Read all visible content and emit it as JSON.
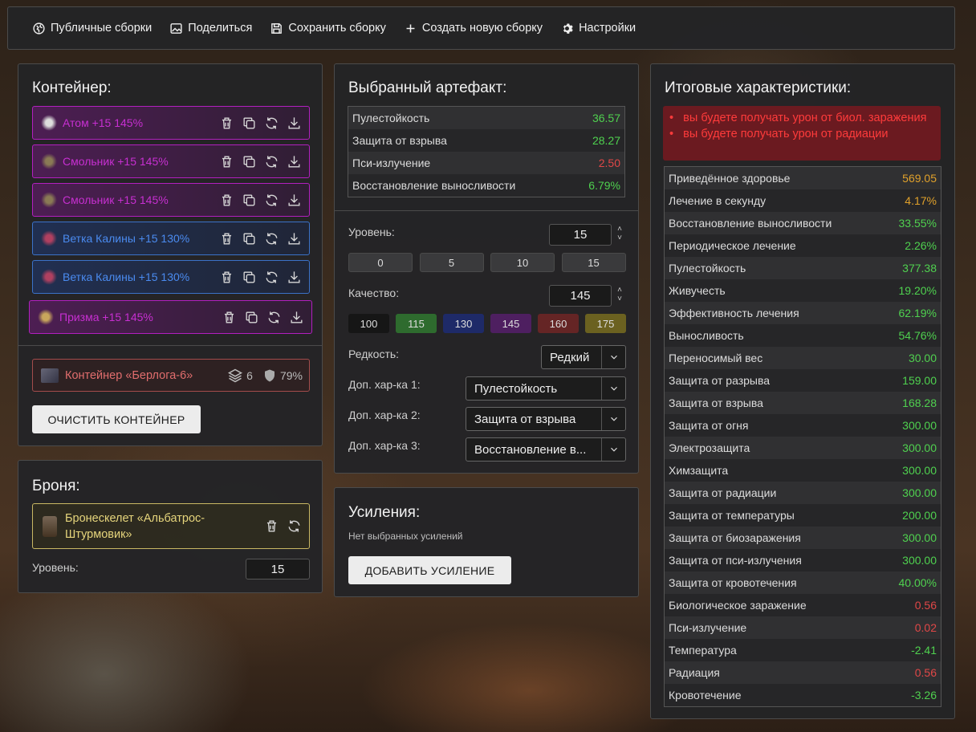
{
  "toolbar": {
    "public_builds": "Публичные сборки",
    "share": "Поделиться",
    "save_build": "Сохранить сборку",
    "new_build": "Создать новую сборку",
    "settings": "Настройки"
  },
  "container": {
    "title": "Контейнер:",
    "artifacts": [
      {
        "name": "Атом +15 145%",
        "rarity": "purple"
      },
      {
        "name": "Смольник +15 145%",
        "rarity": "purple"
      },
      {
        "name": "Смольник +15 145%",
        "rarity": "purple"
      },
      {
        "name": "Ветка Калины +15 130%",
        "rarity": "blue"
      },
      {
        "name": "Ветка Калины +15 130%",
        "rarity": "blue"
      },
      {
        "name": "Призма +15 145%",
        "rarity": "purple"
      }
    ],
    "container_item": {
      "name": "Контейнер «Берлога-6»",
      "slots": "6",
      "protection": "79%"
    },
    "clear_button": "ОЧИСТИТЬ КОНТЕЙНЕР"
  },
  "armor": {
    "title": "Броня:",
    "name": "Бронескелет «Альбатрос-Штурмовик»",
    "level_label": "Уровень:",
    "level_value": "15"
  },
  "selected_artifact": {
    "title": "Выбранный артефакт:",
    "stats": [
      {
        "label": "Пулестойкость",
        "value": "36.57",
        "color": "g"
      },
      {
        "label": "Защита от взрыва",
        "value": "28.27",
        "color": "g"
      },
      {
        "label": "Пси-излучение",
        "value": "2.50",
        "color": "r"
      },
      {
        "label": "Восстановление выносливости",
        "value": "6.79%",
        "color": "g"
      }
    ],
    "level_label": "Уровень:",
    "level_value": "15",
    "level_presets": [
      "0",
      "5",
      "10",
      "15"
    ],
    "quality_label": "Качество:",
    "quality_value": "145",
    "quality_presets": [
      {
        "label": "100",
        "color": "#161616"
      },
      {
        "label": "115",
        "color": "#2e6b2e"
      },
      {
        "label": "130",
        "color": "#1e2a68"
      },
      {
        "label": "145",
        "color": "#4e1f60"
      },
      {
        "label": "160",
        "color": "#652525"
      },
      {
        "label": "175",
        "color": "#6b6120"
      }
    ],
    "rarity_label": "Редкость:",
    "rarity_value": "Редкий",
    "extra1_label": "Доп. хар-ка 1:",
    "extra1_value": "Пулестойкость",
    "extra2_label": "Доп. хар-ка 2:",
    "extra2_value": "Защита от взрыва",
    "extra3_label": "Доп. хар-ка 3:",
    "extra3_value": "Восстановление в..."
  },
  "boosts": {
    "title": "Усиления:",
    "empty_text": "Нет выбранных усилений",
    "add_button": "ДОБАВИТЬ УСИЛЕНИЕ"
  },
  "totals": {
    "title": "Итоговые характеристики:",
    "warnings": [
      "вы будете получать урон от биол. заражения",
      "вы будете получать урон от радиации"
    ],
    "stats": [
      {
        "label": "Приведённое здоровье",
        "value": "569.05",
        "color": "o"
      },
      {
        "label": "Лечение в секунду",
        "value": "4.17%",
        "color": "o"
      },
      {
        "label": "Восстановление выносливости",
        "value": "33.55%",
        "color": "g"
      },
      {
        "label": "Периодическое лечение",
        "value": "2.26%",
        "color": "g"
      },
      {
        "label": "Пулестойкость",
        "value": "377.38",
        "color": "g"
      },
      {
        "label": "Живучесть",
        "value": "19.20%",
        "color": "g"
      },
      {
        "label": "Эффективность лечения",
        "value": "62.19%",
        "color": "g"
      },
      {
        "label": "Выносливость",
        "value": "54.76%",
        "color": "g"
      },
      {
        "label": "Переносимый вес",
        "value": "30.00",
        "color": "g"
      },
      {
        "label": "Защита от разрыва",
        "value": "159.00",
        "color": "g"
      },
      {
        "label": "Защита от взрыва",
        "value": "168.28",
        "color": "g"
      },
      {
        "label": "Защита от огня",
        "value": "300.00",
        "color": "g"
      },
      {
        "label": "Электрозащита",
        "value": "300.00",
        "color": "g"
      },
      {
        "label": "Химзащита",
        "value": "300.00",
        "color": "g"
      },
      {
        "label": "Защита от радиации",
        "value": "300.00",
        "color": "g"
      },
      {
        "label": "Защита от температуры",
        "value": "200.00",
        "color": "g"
      },
      {
        "label": "Защита от биозаражения",
        "value": "300.00",
        "color": "g"
      },
      {
        "label": "Защита от пси-излучения",
        "value": "300.00",
        "color": "g"
      },
      {
        "label": "Защита от кровотечения",
        "value": "40.00%",
        "color": "g"
      },
      {
        "label": "Биологическое заражение",
        "value": "0.56",
        "color": "r"
      },
      {
        "label": "Пси-излучение",
        "value": "0.02",
        "color": "r"
      },
      {
        "label": "Температура",
        "value": "-2.41",
        "color": "g"
      },
      {
        "label": "Радиация",
        "value": "0.56",
        "color": "r"
      },
      {
        "label": "Кровотечение",
        "value": "-3.26",
        "color": "g"
      }
    ]
  }
}
